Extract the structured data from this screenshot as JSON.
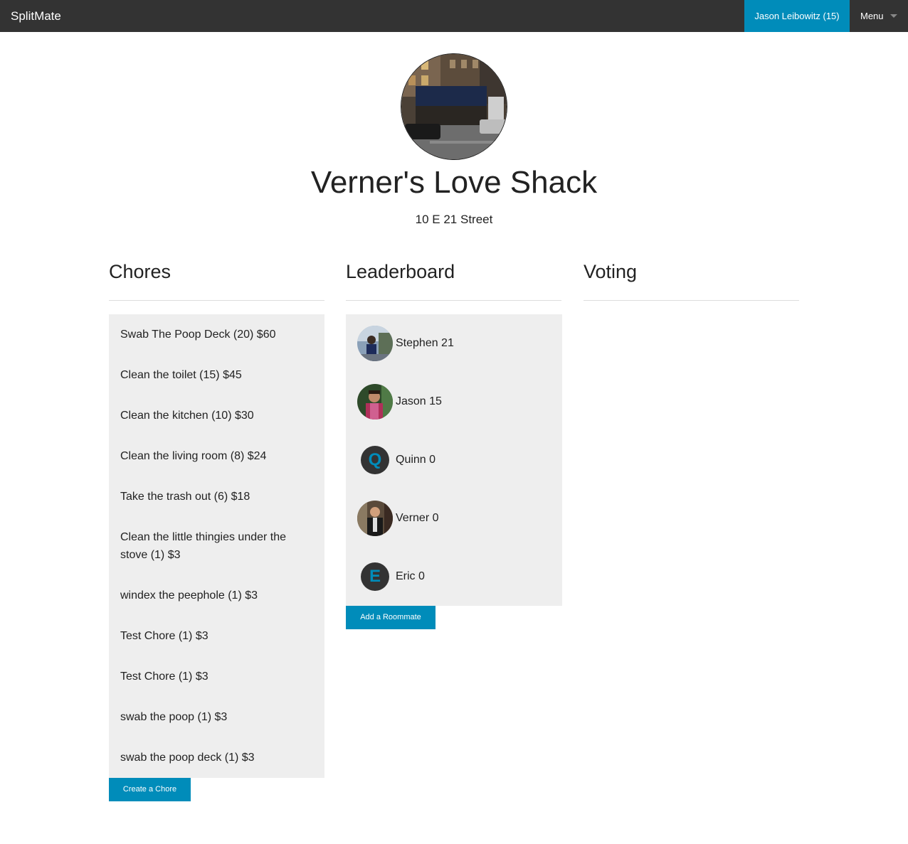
{
  "nav": {
    "brand": "SplitMate",
    "user": "Jason Leibowitz (15)",
    "menu": "Menu"
  },
  "house": {
    "name": "Verner's Love Shack",
    "address": "10 E 21 Street"
  },
  "sections": {
    "chores": "Chores",
    "leaderboard": "Leaderboard",
    "voting": "Voting"
  },
  "chores": [
    "Swab The Poop Deck (20) $60",
    "Clean the toilet (15) $45",
    "Clean the kitchen (10) $30",
    "Clean the living room (8) $24",
    "Take the trash out (6) $18",
    "Clean the little thingies under the stove (1) $3",
    "windex the peephole (1) $3",
    "Test Chore (1) $3",
    "Test Chore (1) $3",
    "swab the poop (1) $3",
    "swab the poop deck (1) $3"
  ],
  "leaderboard": [
    {
      "label": "Stephen 21",
      "avatar": "photo"
    },
    {
      "label": "Jason 15",
      "avatar": "photo"
    },
    {
      "label": "Quinn 0",
      "avatar": "letter",
      "letter": "Q"
    },
    {
      "label": "Verner 0",
      "avatar": "photo"
    },
    {
      "label": "Eric 0",
      "avatar": "letter",
      "letter": "E"
    }
  ],
  "buttons": {
    "create_chore": "Create a Chore",
    "add_roommate": "Add a Roommate"
  },
  "colors": {
    "accent": "#008cba",
    "topbar": "#333333",
    "panel": "#eeeeee"
  }
}
